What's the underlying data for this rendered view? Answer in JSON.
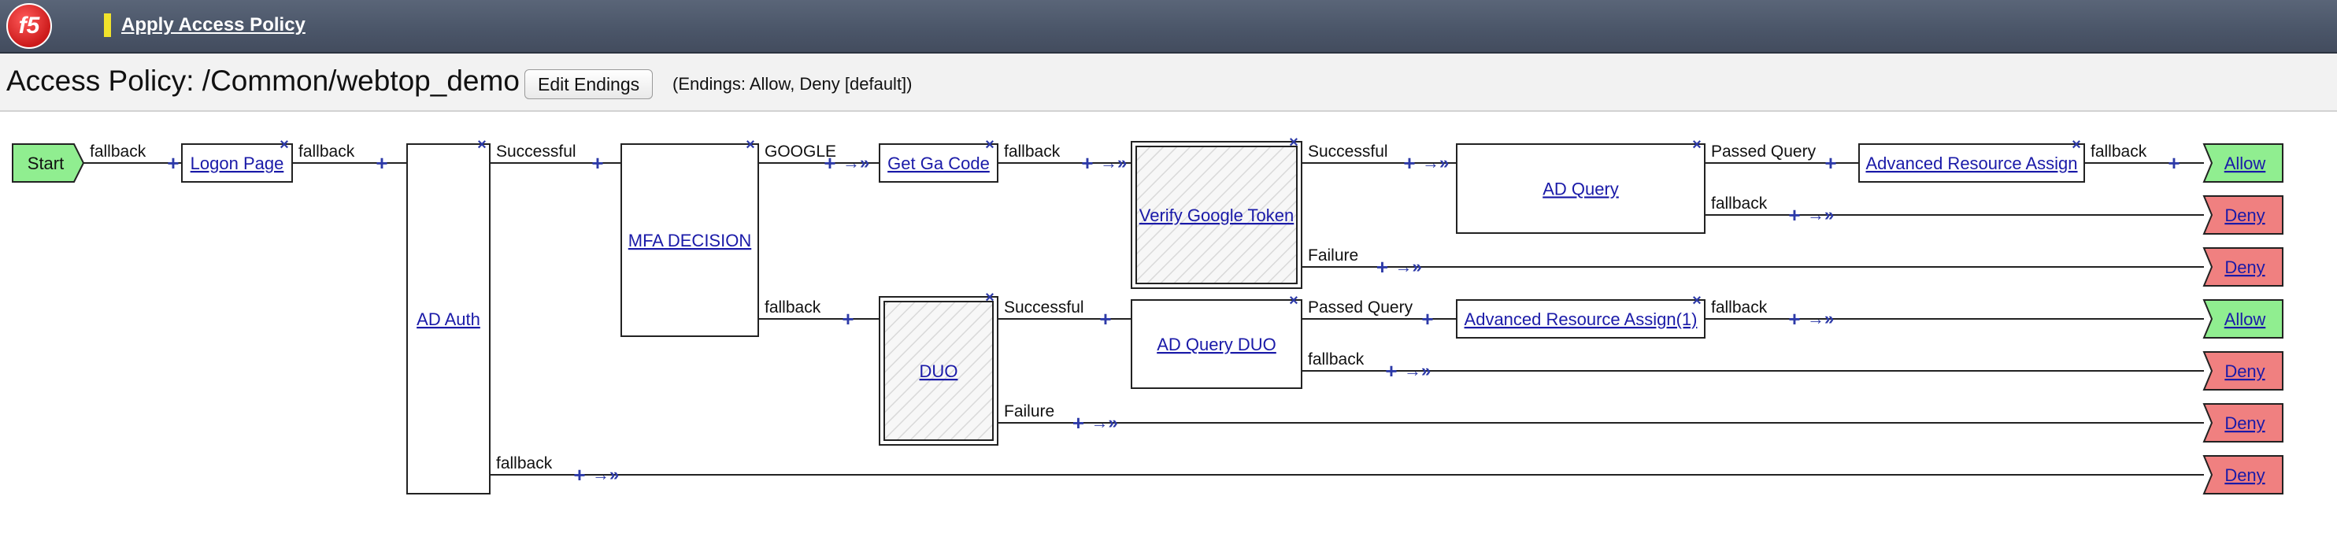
{
  "header": {
    "logo_text": "f5",
    "apply_label": "Apply Access Policy"
  },
  "policy": {
    "title": "Access Policy: /Common/webtop_demo",
    "edit_endings_label": "Edit Endings",
    "endings_info": "(Endings: Allow, Deny [default])"
  },
  "flow": {
    "start_label": "Start",
    "nodes": [
      {
        "id": "logon-page",
        "label": "Logon Page"
      },
      {
        "id": "ad-auth",
        "label": "AD Auth"
      },
      {
        "id": "mfa-decision",
        "label": "MFA DECISION"
      },
      {
        "id": "get-ga-code",
        "label": "Get Ga Code"
      },
      {
        "id": "verify-google-token",
        "label": "Verify Google Token"
      },
      {
        "id": "ad-query",
        "label": "AD Query"
      },
      {
        "id": "advanced-resource-assign",
        "label": "Advanced Resource Assign"
      },
      {
        "id": "duo",
        "label": "DUO"
      },
      {
        "id": "ad-query-duo",
        "label": "AD Query DUO"
      },
      {
        "id": "advanced-resource-assign-1",
        "label": "Advanced Resource Assign(1)"
      }
    ],
    "branches": [
      {
        "id": "start-fallback",
        "label": "fallback"
      },
      {
        "id": "logon-fallback",
        "label": "fallback"
      },
      {
        "id": "adauth-successful",
        "label": "Successful"
      },
      {
        "id": "adauth-fallback",
        "label": "fallback"
      },
      {
        "id": "mfa-google",
        "label": "GOOGLE"
      },
      {
        "id": "mfa-fallback",
        "label": "fallback"
      },
      {
        "id": "gacode-fallback",
        "label": "fallback"
      },
      {
        "id": "verify-successful",
        "label": "Successful"
      },
      {
        "id": "verify-failure",
        "label": "Failure"
      },
      {
        "id": "adquery-passed",
        "label": "Passed Query"
      },
      {
        "id": "adquery-fallback",
        "label": "fallback"
      },
      {
        "id": "ara-fallback",
        "label": "fallback"
      },
      {
        "id": "duo-successful",
        "label": "Successful"
      },
      {
        "id": "duo-failure",
        "label": "Failure"
      },
      {
        "id": "adqueryduo-passed",
        "label": "Passed Query"
      },
      {
        "id": "adqueryduo-fallback",
        "label": "fallback"
      },
      {
        "id": "ara1-fallback",
        "label": "fallback"
      }
    ],
    "endings": [
      {
        "id": "ending-1",
        "label": "Allow",
        "type": "allow"
      },
      {
        "id": "ending-2",
        "label": "Deny",
        "type": "deny"
      },
      {
        "id": "ending-3",
        "label": "Deny",
        "type": "deny"
      },
      {
        "id": "ending-4",
        "label": "Allow",
        "type": "allow"
      },
      {
        "id": "ending-5",
        "label": "Deny",
        "type": "deny"
      },
      {
        "id": "ending-6",
        "label": "Deny",
        "type": "deny"
      },
      {
        "id": "ending-7",
        "label": "Deny",
        "type": "deny"
      }
    ]
  },
  "icons": {
    "add": "plus-icon",
    "connector": "double-chevron-right-icon",
    "remove": "close-icon"
  },
  "colors": {
    "allow": "#90ee90",
    "deny": "#f08080",
    "start": "#90ee90",
    "link": "#1a1aa8",
    "icon": "#2d3aa8"
  }
}
